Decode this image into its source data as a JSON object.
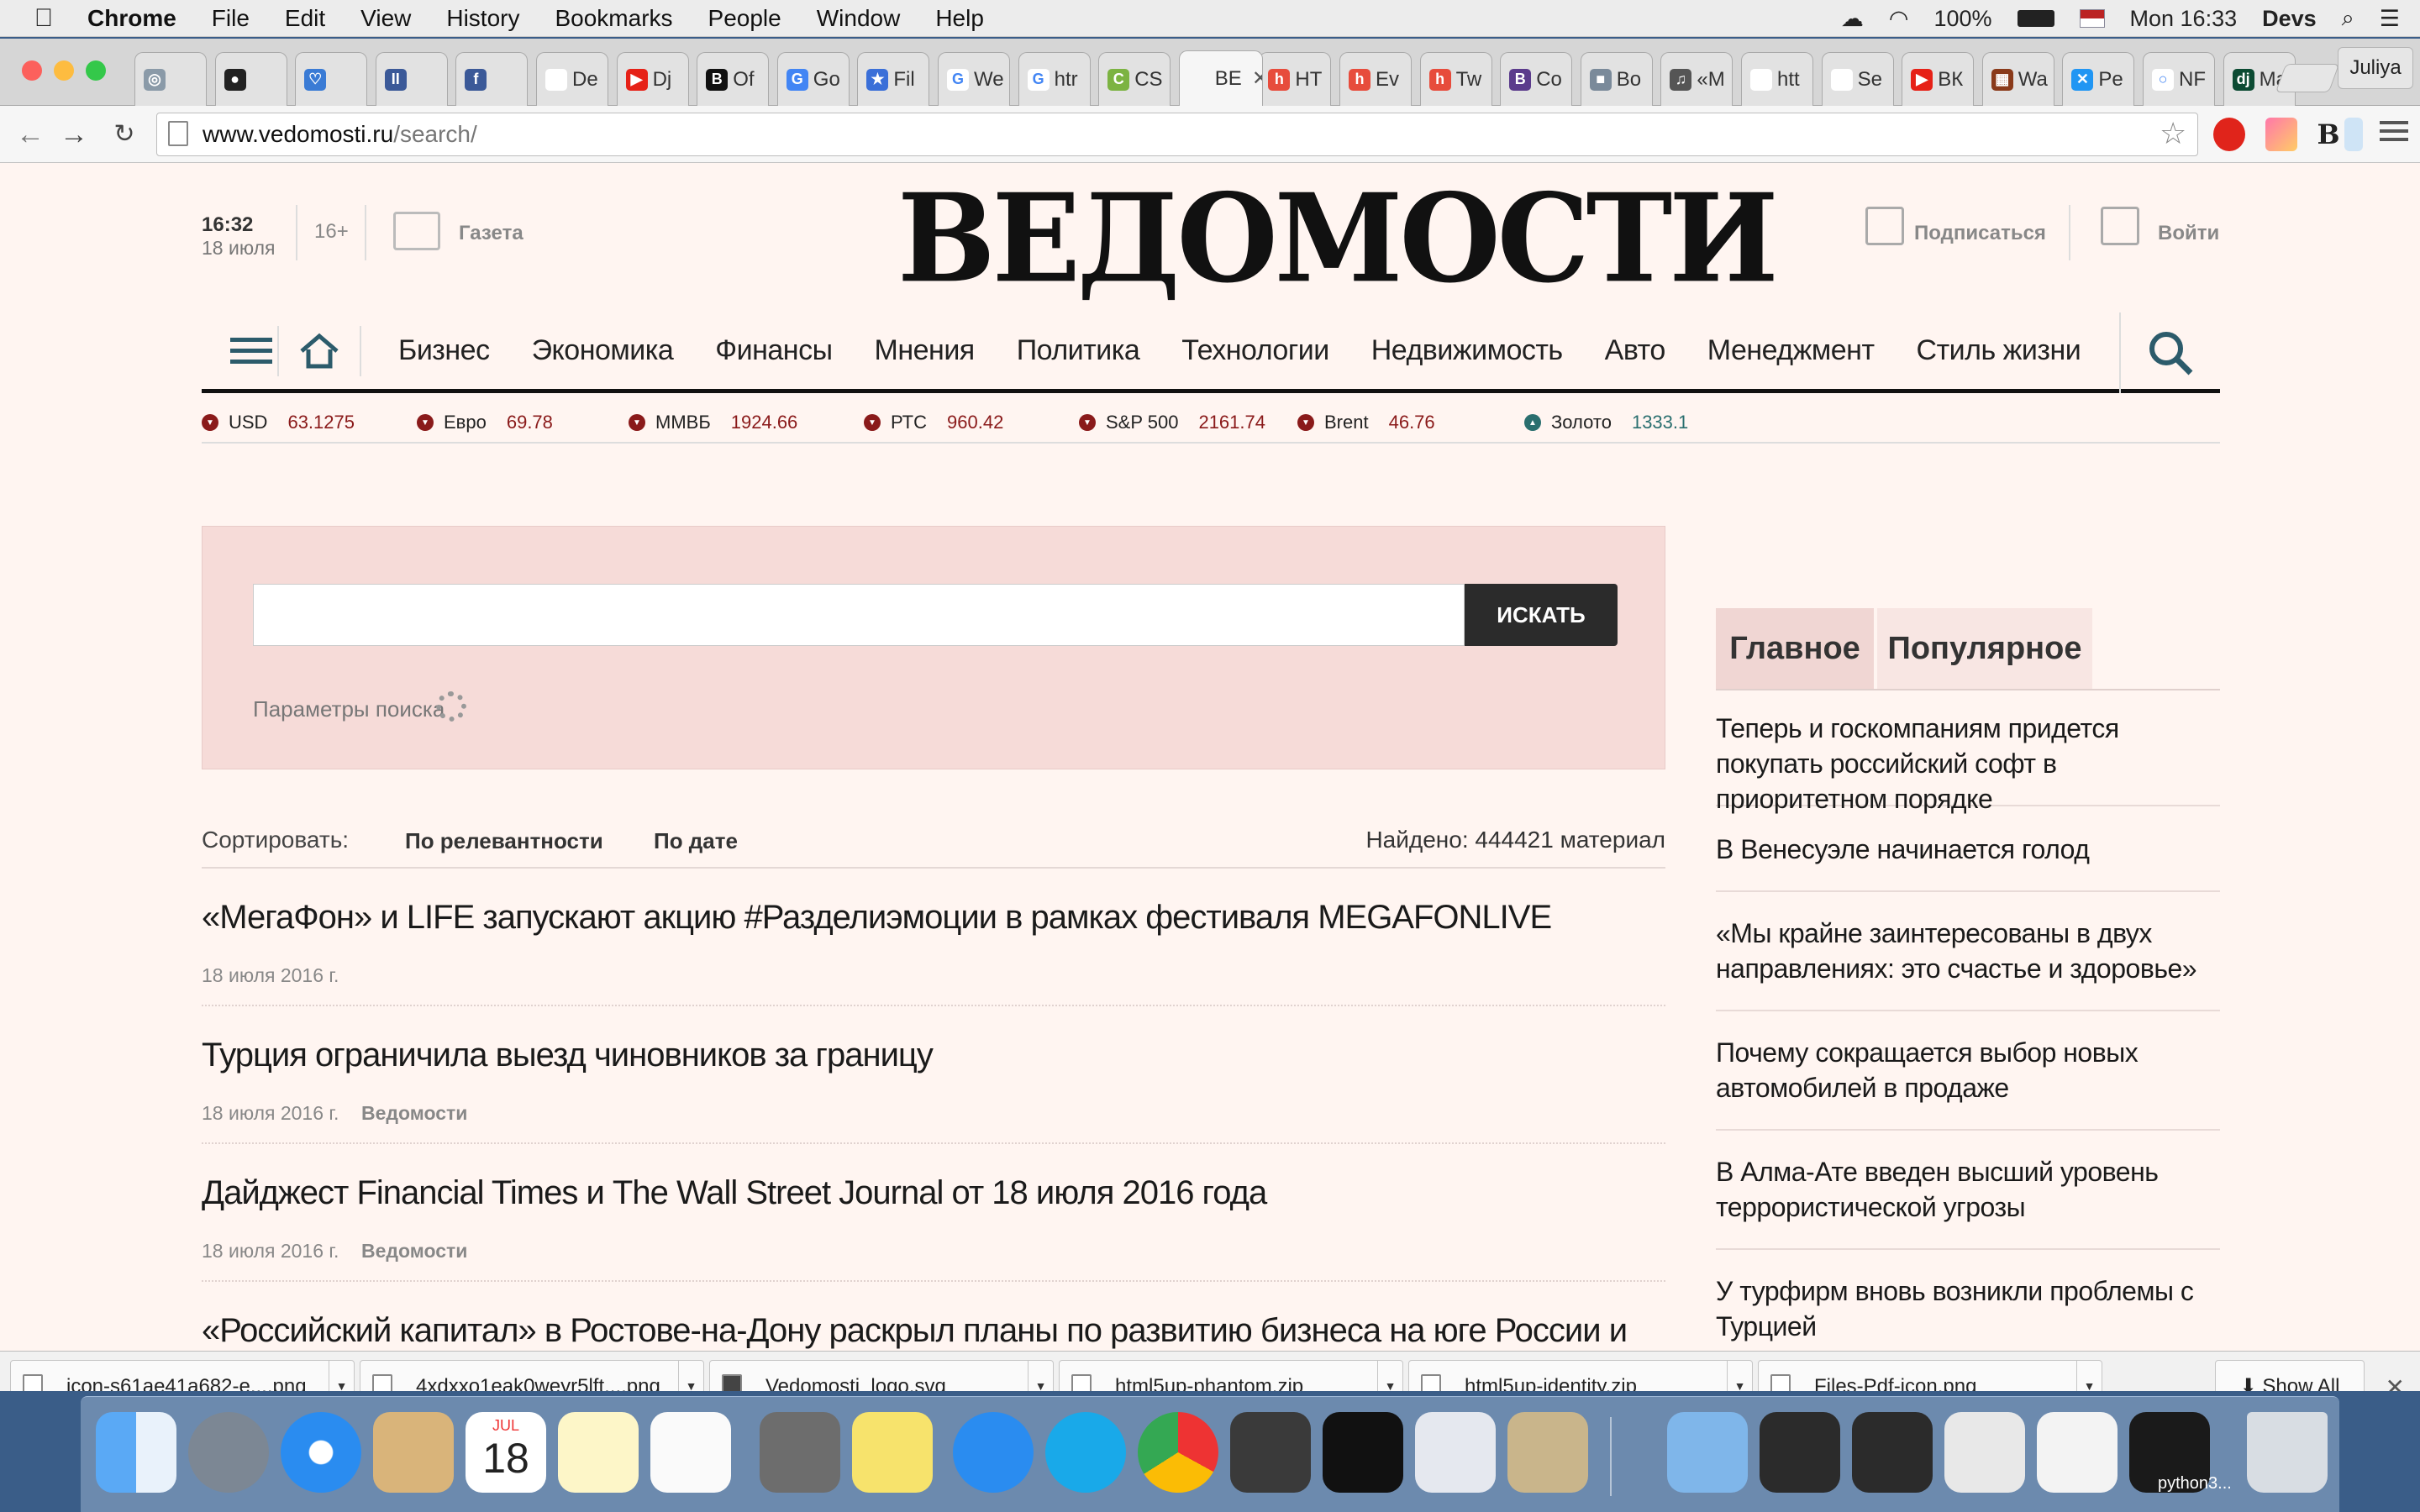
{
  "menubar": {
    "app": "Chrome",
    "items": [
      "File",
      "Edit",
      "View",
      "History",
      "Bookmarks",
      "People",
      "Window",
      "Help"
    ],
    "battery": "100%",
    "clock": "Mon 16:33",
    "user": "Devs"
  },
  "tabs": [
    {
      "label": "",
      "color": "#8a9aa8",
      "glyph": "◎"
    },
    {
      "label": "",
      "color": "#222222",
      "glyph": "●"
    },
    {
      "label": "",
      "color": "#3a7bd5",
      "glyph": "♡"
    },
    {
      "label": "",
      "color": "#3b5998",
      "glyph": "II"
    },
    {
      "label": "",
      "color": "#3b5998",
      "glyph": "f"
    },
    {
      "label": "De",
      "color": "#ffffff",
      "glyph": ""
    },
    {
      "label": "Dj",
      "color": "#e62117",
      "glyph": "▶"
    },
    {
      "label": "Of",
      "color": "#111111",
      "glyph": "B"
    },
    {
      "label": "Go",
      "color": "#4285f4",
      "glyph": "G"
    },
    {
      "label": "Fil",
      "color": "#3a6fd8",
      "glyph": "★"
    },
    {
      "label": "We",
      "color": "#ffffff",
      "glyph": "G"
    },
    {
      "label": "htr",
      "color": "#ffffff",
      "glyph": "G"
    },
    {
      "label": "CS",
      "color": "#7cb342",
      "glyph": "C"
    },
    {
      "label": "ВЕ",
      "color": "#f6f6f6",
      "glyph": ""
    },
    {
      "label": "HT",
      "color": "#e74c3c",
      "glyph": "h"
    },
    {
      "label": "Ev",
      "color": "#e74c3c",
      "glyph": "h"
    },
    {
      "label": "Tw",
      "color": "#e74c3c",
      "glyph": "h"
    },
    {
      "label": "Co",
      "color": "#5b3b8c",
      "glyph": "B"
    },
    {
      "label": "Bo",
      "color": "#7a8a9a",
      "glyph": "■"
    },
    {
      "label": "«M",
      "color": "#555555",
      "glyph": "♫"
    },
    {
      "label": "htt",
      "color": "#ffffff",
      "glyph": ""
    },
    {
      "label": "Se",
      "color": "#ffffff",
      "glyph": ""
    },
    {
      "label": "ВК",
      "color": "#e62117",
      "glyph": "▶"
    },
    {
      "label": "Wa",
      "color": "#8a3a1a",
      "glyph": "▦"
    },
    {
      "label": "Pe",
      "color": "#2196f3",
      "glyph": "✕"
    },
    {
      "label": "NF",
      "color": "#ffffff",
      "glyph": "○"
    },
    {
      "label": "Ma",
      "color": "#0c4b33",
      "glyph": "dj"
    }
  ],
  "profile": "Juliya",
  "url": {
    "host": "www.vedomosti.ru",
    "path": "/search/"
  },
  "site": {
    "time": "16:32",
    "date": "18 июля",
    "age": "16+",
    "gazeta": "Газета",
    "logo": "ВЕДОМОСТИ",
    "subscribe": "Подписаться",
    "login": "Войти"
  },
  "nav": [
    "Бизнес",
    "Экономика",
    "Финансы",
    "Мнения",
    "Политика",
    "Технологии",
    "Недвижимость",
    "Авто",
    "Менеджмент",
    "Стиль жизни"
  ],
  "tickers": [
    {
      "name": "USD",
      "value": "63.1275",
      "dir": "down"
    },
    {
      "name": "Евро",
      "value": "69.78",
      "dir": "down"
    },
    {
      "name": "ММВБ",
      "value": "1924.66",
      "dir": "down"
    },
    {
      "name": "РТС",
      "value": "960.42",
      "dir": "down"
    },
    {
      "name": "S&P 500",
      "value": "2161.74",
      "dir": "down"
    },
    {
      "name": "Brent",
      "value": "46.76",
      "dir": "down"
    },
    {
      "name": "Золото",
      "value": "1333.1",
      "dir": "up"
    }
  ],
  "search": {
    "value": "",
    "placeholder": "",
    "button": "ИСКАТЬ",
    "params": "Параметры поиска"
  },
  "sort": {
    "label": "Сортировать:",
    "options": [
      "По релевантности",
      "По дате"
    ],
    "found": "Найдено: 444421 материал"
  },
  "articles": [
    {
      "title": "«МегаФон» и LIFE запускают акцию #Разделиэмоции в рамках фестиваля MEGAFONLIVE",
      "date": "18 июля 2016 г.",
      "source": ""
    },
    {
      "title": "Турция ограничила выезд чиновников за границу",
      "date": "18 июля 2016 г.",
      "source": "Ведомости"
    },
    {
      "title": "Дайджест Financial Times и The Wall Street Journal от 18 июля 2016 года",
      "date": "18 июля 2016 г.",
      "source": "Ведомости"
    },
    {
      "title": "«Российский капитал» в Ростове-на-Дону раскрыл планы по развитию бизнеса на юге России и",
      "date": "",
      "source": ""
    }
  ],
  "sidebar": {
    "tabs": [
      "Главное",
      "Популярное"
    ],
    "items": [
      "Теперь и госкомпаниям придется покупать российский софт в приоритетном порядке",
      "В Венесуэле начинается голод",
      "«Мы крайне заинтересованы в двух направлениях: это счастье и здоровье»",
      "Почему сокращается выбор новых автомобилей в продаже",
      "В Алма-Ате введен высший уровень террористической угрозы",
      "У турфирм вновь возникли проблемы с Турцией"
    ]
  },
  "downloads": [
    "icon-s61ae41a682-e....png",
    "4xdxxo1eak0weyr5lft....png",
    "Vedomosti_logo.svg",
    "html5up-phantom.zip",
    "html5up-identity.zip",
    "Files-Pdf-icon.png"
  ],
  "show_all": "Show All",
  "dock": {
    "calendar_month": "JUL",
    "calendar_day": "18",
    "last_label": "python3..."
  },
  "colors": {
    "down": "#8a1a1a",
    "up": "#2a6f6f",
    "accent": "#2c5b6b"
  }
}
